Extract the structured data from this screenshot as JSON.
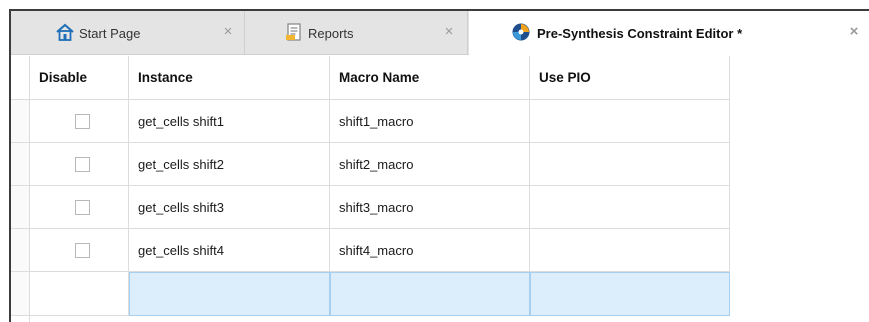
{
  "tabs": [
    {
      "label": "Start Page",
      "icon": "home-icon",
      "active": false
    },
    {
      "label": "Reports",
      "icon": "report-document-icon",
      "active": false
    },
    {
      "label": "Pre-Synthesis Constraint Editor *",
      "icon": "constraint-editor-icon",
      "active": true
    }
  ],
  "table": {
    "columns": [
      "Disable",
      "Instance",
      "Macro Name",
      "Use PIO"
    ],
    "rows": [
      {
        "disable": false,
        "instance": "get_cells shift1",
        "macro_name": "shift1_macro",
        "use_pio": ""
      },
      {
        "disable": false,
        "instance": "get_cells shift2",
        "macro_name": "shift2_macro",
        "use_pio": ""
      },
      {
        "disable": false,
        "instance": "get_cells shift3",
        "macro_name": "shift3_macro",
        "use_pio": ""
      },
      {
        "disable": false,
        "instance": "get_cells shift4",
        "macro_name": "shift4_macro",
        "use_pio": ""
      }
    ],
    "new_row": {
      "instance": "",
      "macro_name": "",
      "use_pio": ""
    }
  },
  "colors": {
    "new_row_fill": "#dceefb",
    "tabbar_bg": "#e4e4e4",
    "home_icon": "#1e6fb8"
  }
}
